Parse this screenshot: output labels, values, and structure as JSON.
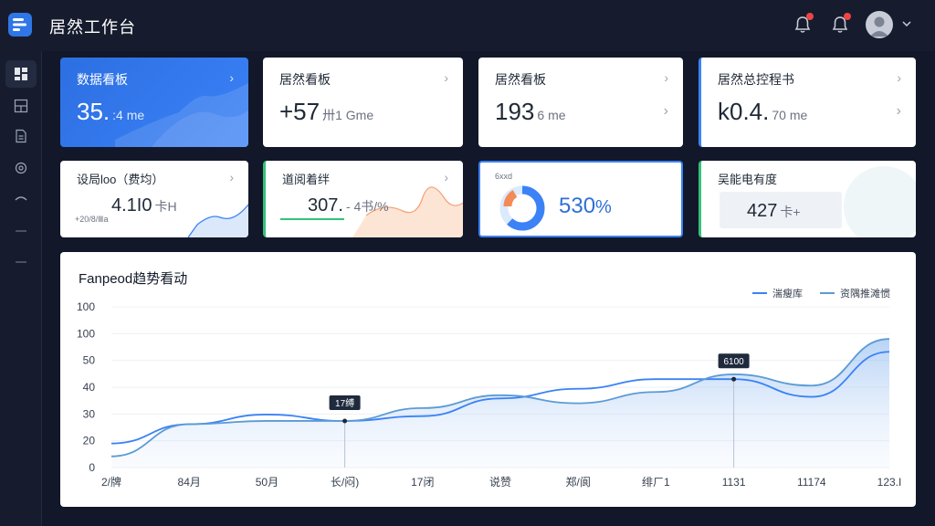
{
  "app": {
    "title": "居然工作台"
  },
  "topbar": {
    "icons": [
      "bell-icon",
      "bell-alert-icon",
      "avatar",
      "chevron-down-icon"
    ]
  },
  "sidebar": {
    "items": [
      {
        "icon": "dashboard-icon",
        "active": true
      },
      {
        "icon": "layout-icon",
        "active": false
      },
      {
        "icon": "document-icon",
        "active": false
      },
      {
        "icon": "settings-icon",
        "active": false
      },
      {
        "icon": "link-icon",
        "active": false
      },
      {
        "icon": "dash-icon",
        "active": false
      },
      {
        "icon": "dash-icon",
        "active": false
      }
    ]
  },
  "cards": [
    {
      "title": "数据看板",
      "value": "35.",
      "unit": ":4 me"
    },
    {
      "title": "居然看板",
      "value": "+57",
      "unit": "卅1 Gme"
    },
    {
      "title": "居然看板",
      "value": "193",
      "unit": "6 me"
    },
    {
      "title": "居然总控程书",
      "value": "k0.4.",
      "unit": "70 me"
    }
  ],
  "small_cards": [
    {
      "title": "设局loo（费均）",
      "value": "4.1I0",
      "unit": "卡H",
      "sub": "+20/8/Ⅲa"
    },
    {
      "title": "道阅着绊",
      "value": "307.",
      "unit": "- 4书/%"
    },
    {
      "label": "6xxd",
      "value": "530",
      "unit": "%",
      "gauge_fraction": 0.62
    },
    {
      "title": "吴能电有度",
      "value": "427",
      "unit": "卡+"
    }
  ],
  "chart_data": {
    "type": "area",
    "title": "Fanpeod趋势看动",
    "legend": [
      "湍瘦库",
      "资隅推滩惯"
    ],
    "y_ticks": [
      "100",
      "100",
      "50",
      "40",
      "30",
      "20",
      "0"
    ],
    "x": [
      "2/牌",
      "84月",
      "50月",
      "长/闷)",
      "17闭",
      "说赞",
      "郑/阆",
      "绯ㄏ1",
      "1131",
      "11174",
      "123.I"
    ],
    "series": [
      {
        "name": "湍瘦库",
        "color": "#3b82f6",
        "values": [
          15,
          27,
          33,
          29,
          32,
          43,
          49,
          55,
          55,
          44,
          72
        ]
      },
      {
        "name": "资隅推滩惯",
        "color": "#5b9bd5",
        "values": [
          7,
          27,
          29,
          29,
          37,
          45,
          40,
          47,
          58,
          51,
          80
        ]
      }
    ],
    "annotations": [
      {
        "label": "17缚",
        "x_index": 3,
        "y": 29
      },
      {
        "label": "6100",
        "x_index": 8,
        "y": 55
      }
    ],
    "ylim": [
      0,
      100
    ]
  }
}
